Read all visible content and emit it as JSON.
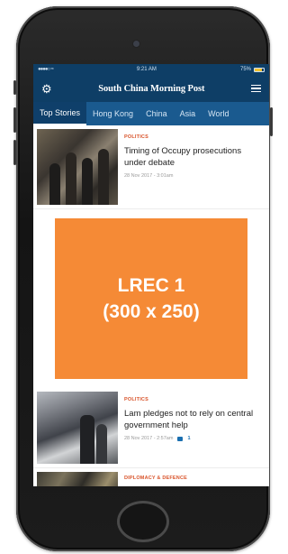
{
  "status_bar": {
    "carrier": "●●●●○   ≈",
    "time": "9:21 AM",
    "battery_text": "75%",
    "battery_level": 0.75
  },
  "header": {
    "title": "South China Morning Post",
    "settings_icon": "gear-icon",
    "menu_icon": "hamburger-menu-icon"
  },
  "tabs": [
    "Top Stories",
    "Hong Kong",
    "China",
    "Asia",
    "World"
  ],
  "active_tab_index": 0,
  "articles": [
    {
      "category": "POLITICS",
      "headline": "Timing of Occupy prosecutions under debate",
      "meta": "28 Nov 2017 - 3:01am"
    },
    {
      "category": "POLITICS",
      "headline": "Lam pledges not to rely on central government help",
      "meta": "28 Nov 2017 - 2:57am",
      "comments": "1"
    },
    {
      "category": "DIPLOMACY & DEFENCE",
      "headline": "",
      "meta": ""
    }
  ],
  "ad": {
    "line1": "LREC 1",
    "line2": "(300 x 250)",
    "color": "#f58a36"
  },
  "colors": {
    "header": "#0e3e66",
    "tab_bar": "#1a5a8f",
    "category": "#d9542b"
  }
}
